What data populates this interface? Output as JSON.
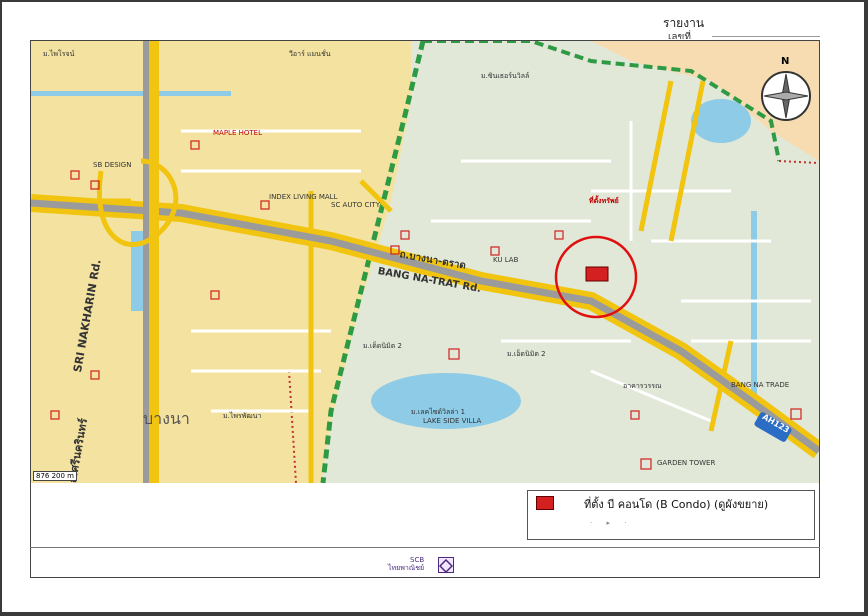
{
  "header": {
    "title": "รายงาน",
    "subtitle": "เลขที่"
  },
  "map": {
    "roads": {
      "bangna_trat_en": "BANG NA-TRAT Rd.",
      "bangna_trat_th": "ถ.บางนา-ตราด",
      "srinakarin_en": "SRI NAKHARIN Rd.",
      "srinakarin_th": "ถ.ศรีนครินทร์",
      "highway": "AH123"
    },
    "district": "บางนา",
    "places": [
      "ม.ไพโรจน์",
      "ม.ซินเธอร์นวิลล์",
      "วีอาร์ แมนชั่น",
      "MAPLE HOTEL",
      "SB DESIGN",
      "INDEX LIVING MALL",
      "SC AUTO CITY",
      "KU LAB",
      "ที่ตั้งทรัพย์",
      "LAKE SIDE VILLA",
      "GARDEN TOWER",
      "BANG NA TRADE",
      "อาคารวรรณ",
      "ม.เด็ดนิมิต 2",
      "ม.เอ็ดนิมิต 2",
      "ม.เลคไซด์วิลล่า 1",
      "ม.ไพรพัฒนา"
    ],
    "subject_marker": "ที่ตั้งทรัพย์",
    "scale_text": "876 200 m"
  },
  "legend": {
    "label": "ที่ตั้ง บี คอนโด (B Condo) (ดูผังขยาย)",
    "swatch_color": "#d42020"
  },
  "footer": {
    "brand_line1": "SCB",
    "brand_line2": "ไทยพาณิชย์"
  },
  "compass": {
    "north_label": "N"
  }
}
